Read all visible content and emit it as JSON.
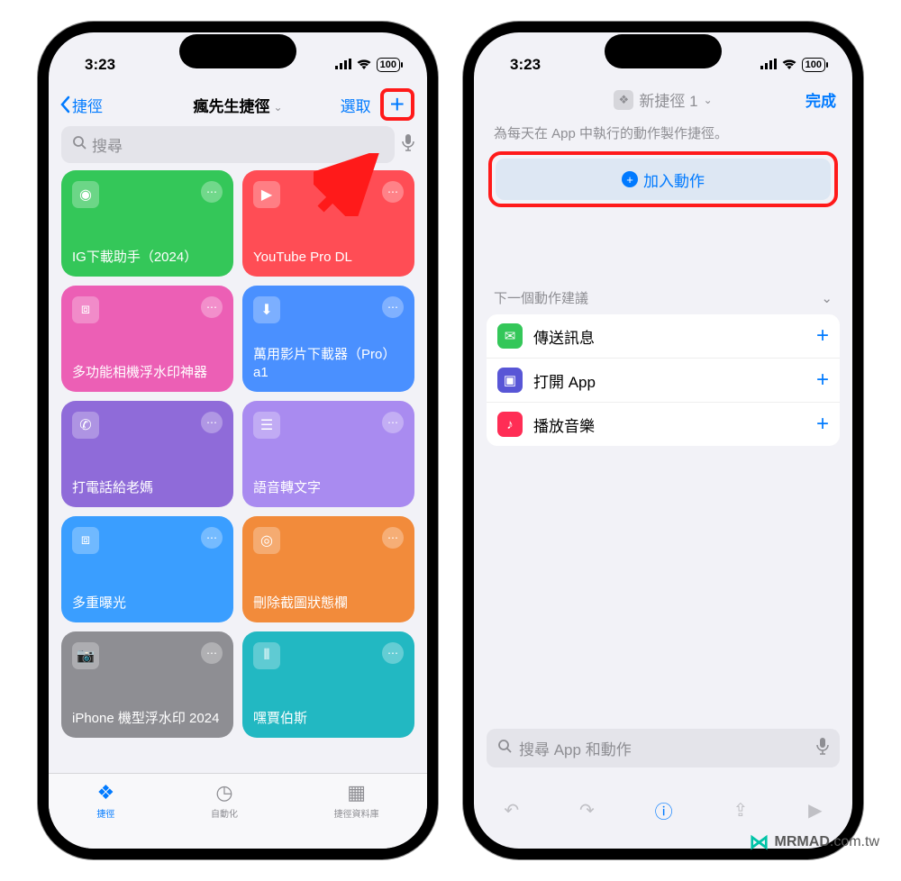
{
  "status": {
    "time": "3:23",
    "battery": "100"
  },
  "left": {
    "back": "捷徑",
    "title": "瘋先生捷徑",
    "select": "選取",
    "search_placeholder": "搜尋",
    "tiles": [
      {
        "label": "IG下載助手（2024）",
        "color": "#34c759",
        "icon": "◉"
      },
      {
        "label": "YouTube Pro DL",
        "color": "#ff4d55",
        "icon": "▶"
      },
      {
        "label": "多功能相機浮水印神器",
        "color": "#ec5fb5",
        "icon": "⧈"
      },
      {
        "label": "萬用影片下載器（Pro）a1",
        "color": "#4a90ff",
        "icon": "⬇"
      },
      {
        "label": "打電話給老媽",
        "color": "#8f6bd9",
        "icon": "✆"
      },
      {
        "label": "語音轉文字",
        "color": "#a98bf0",
        "icon": "☰"
      },
      {
        "label": "多重曝光",
        "color": "#3a9eff",
        "icon": "⧈"
      },
      {
        "label": "刪除截圖狀態欄",
        "color": "#f28b3b",
        "icon": "◎"
      },
      {
        "label": "iPhone 機型浮水印 2024",
        "color": "#8e8e93",
        "icon": "📷"
      },
      {
        "label": "嘿賈伯斯",
        "color": "#22b8c2",
        "icon": "⦀"
      }
    ],
    "tabs": {
      "shortcuts": "捷徑",
      "automation": "自動化",
      "gallery": "捷徑資料庫"
    }
  },
  "right": {
    "title": "新捷徑 1",
    "done": "完成",
    "subtitle": "為每天在 App 中執行的動作製作捷徑。",
    "add_action": "加入動作",
    "suggest_header": "下一個動作建議",
    "suggestions": [
      {
        "label": "傳送訊息",
        "icon_bg": "#34c759",
        "icon": "✉"
      },
      {
        "label": "打開 App",
        "icon_bg": "#5856d6",
        "icon": "▣"
      },
      {
        "label": "播放音樂",
        "icon_bg": "#ff2d55",
        "icon": "♪"
      }
    ],
    "bottom_search": "搜尋 App 和動作"
  },
  "watermark": {
    "brand": "MRMAD",
    "suffix": ".com.tw"
  }
}
